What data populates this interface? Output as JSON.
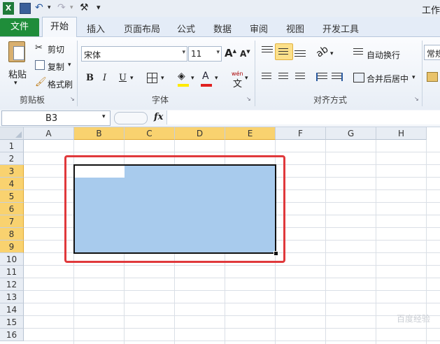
{
  "window": {
    "title": "工作"
  },
  "tabs": {
    "file": "文件",
    "items": [
      "开始",
      "插入",
      "页面布局",
      "公式",
      "数据",
      "审阅",
      "视图",
      "开发工具"
    ]
  },
  "clipboard": {
    "paste": "粘贴",
    "cut": "剪切",
    "copy": "复制",
    "format_painter": "格式刷",
    "group_label": "剪贴板"
  },
  "font": {
    "name": "宋体",
    "size": "11",
    "bold": "B",
    "italic": "I",
    "underline": "U",
    "font_color_glyph": "A",
    "phonetic_glyph": "文",
    "group_label": "字体"
  },
  "alignment": {
    "wrap_text": "自动换行",
    "merge_center": "合并后居中",
    "group_label": "对齐方式"
  },
  "number": {
    "format": "常规"
  },
  "formula_bar": {
    "name_box": "B3",
    "fx": "fx",
    "value": ""
  },
  "sheet": {
    "columns": [
      "A",
      "B",
      "C",
      "D",
      "E",
      "F",
      "G",
      "H"
    ],
    "rows": [
      "1",
      "2",
      "3",
      "4",
      "5",
      "6",
      "7",
      "8",
      "9",
      "10",
      "11",
      "12",
      "13",
      "14",
      "15",
      "16"
    ],
    "selected_columns": [
      "B",
      "C",
      "D",
      "E"
    ],
    "selected_rows": [
      "3",
      "4",
      "5",
      "6",
      "7",
      "8",
      "9"
    ],
    "active_cell": "B3",
    "selection_range": "B3:E9"
  },
  "watermark": "百度经验",
  "colors": {
    "file_tab": "#1f8d3a",
    "selection": "#a8cbed",
    "highlight_box": "#e0393c",
    "header_selected": "#f9d26f"
  }
}
